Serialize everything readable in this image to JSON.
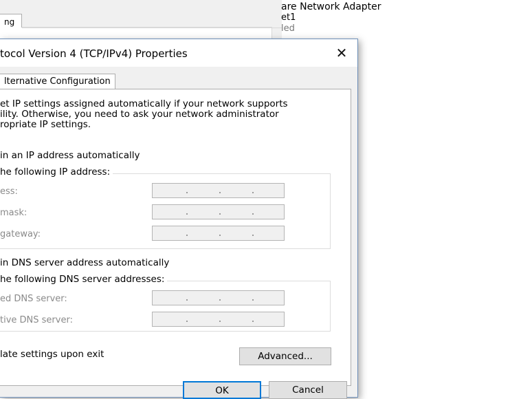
{
  "background": {
    "tab_label": "ng",
    "adapter_name": "are Network Adapter",
    "adapter_sub": "et1",
    "adapter_status": "led"
  },
  "dialog": {
    "title": "tocol Version 4 (TCP/IPv4) Properties",
    "close_glyph": "✕",
    "tab_label": "lternative Configuration",
    "intro_text": "et IP settings assigned automatically if your network supports\nility. Otherwise, you need to ask your network administrator\nropriate IP settings.",
    "ip_auto_label": "in an IP address automatically",
    "ip_manual_label": "he following IP address:",
    "ip_address_label": "ess:",
    "subnet_label": "mask:",
    "gateway_label": "gateway:",
    "dns_auto_label": "in DNS server address automatically",
    "dns_manual_label": "he following DNS server addresses:",
    "preferred_dns_label": "ed DNS server:",
    "alternate_dns_label": "tive DNS server:",
    "validate_label": "late settings upon exit",
    "advanced_button": "Advanced...",
    "ok_button": "OK",
    "cancel_button": "Cancel"
  }
}
